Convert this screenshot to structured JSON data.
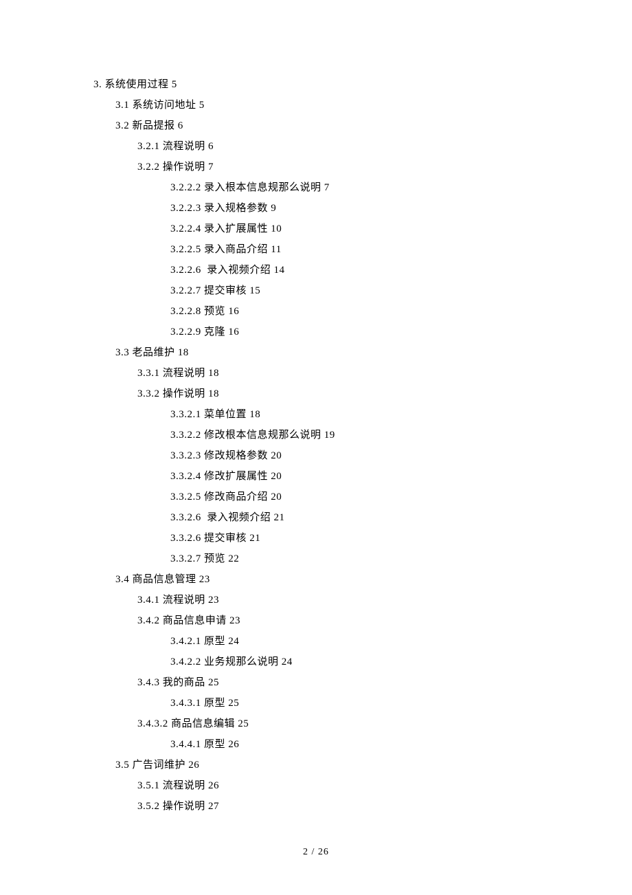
{
  "toc": [
    {
      "level": 1,
      "text": "3. 系统使用过程 5"
    },
    {
      "level": 2,
      "text": "3.1 系统访问地址 5"
    },
    {
      "level": 2,
      "text": "3.2 新品提报 6"
    },
    {
      "level": 3,
      "text": "3.2.1 流程说明 6"
    },
    {
      "level": 3,
      "text": "3.2.2 操作说明 7"
    },
    {
      "level": 4,
      "text": "3.2.2.2 录入根本信息规那么说明 7"
    },
    {
      "level": 4,
      "text": "3.2.2.3 录入规格参数 9"
    },
    {
      "level": 4,
      "text": "3.2.2.4 录入扩展属性 10"
    },
    {
      "level": 4,
      "text": "3.2.2.5 录入商品介绍 11"
    },
    {
      "level": 4,
      "text": "3.2.2.6  录入视频介绍 14"
    },
    {
      "level": 4,
      "text": "3.2.2.7 提交审核 15"
    },
    {
      "level": 4,
      "text": "3.2.2.8 预览 16"
    },
    {
      "level": 4,
      "text": "3.2.2.9 克隆 16"
    },
    {
      "level": 2,
      "text": "3.3 老品维护 18"
    },
    {
      "level": 3,
      "text": "3.3.1 流程说明 18"
    },
    {
      "level": 3,
      "text": "3.3.2 操作说明 18"
    },
    {
      "level": 4,
      "text": "3.3.2.1 菜单位置 18"
    },
    {
      "level": 4,
      "text": "3.3.2.2 修改根本信息规那么说明 19"
    },
    {
      "level": 4,
      "text": "3.3.2.3 修改规格参数 20"
    },
    {
      "level": 4,
      "text": "3.3.2.4 修改扩展属性 20"
    },
    {
      "level": 4,
      "text": "3.3.2.5 修改商品介绍 20"
    },
    {
      "level": 4,
      "text": "3.3.2.6  录入视频介绍 21"
    },
    {
      "level": 4,
      "text": "3.3.2.6 提交审核 21"
    },
    {
      "level": 4,
      "text": "3.3.2.7 预览 22"
    },
    {
      "level": 2,
      "text": "3.4 商品信息管理 23"
    },
    {
      "level": 3,
      "text": "3.4.1 流程说明 23"
    },
    {
      "level": 3,
      "text": "3.4.2 商品信息申请 23"
    },
    {
      "level": 4,
      "text": "3.4.2.1 原型 24"
    },
    {
      "level": 4,
      "text": "3.4.2.2 业务规那么说明 24"
    },
    {
      "level": 3,
      "text": "3.4.3 我的商品 25"
    },
    {
      "level": 4,
      "text": "3.4.3.1 原型 25"
    },
    {
      "level": 3,
      "text": "3.4.3.2 商品信息编辑 25"
    },
    {
      "level": 4,
      "text": "3.4.4.1 原型 26"
    },
    {
      "level": 2,
      "text": "3.5 广告词维护 26"
    },
    {
      "level": 3,
      "text": "3.5.1 流程说明 26"
    },
    {
      "level": 3,
      "text": "3.5.2 操作说明 27"
    }
  ],
  "footer": "2  /  26"
}
